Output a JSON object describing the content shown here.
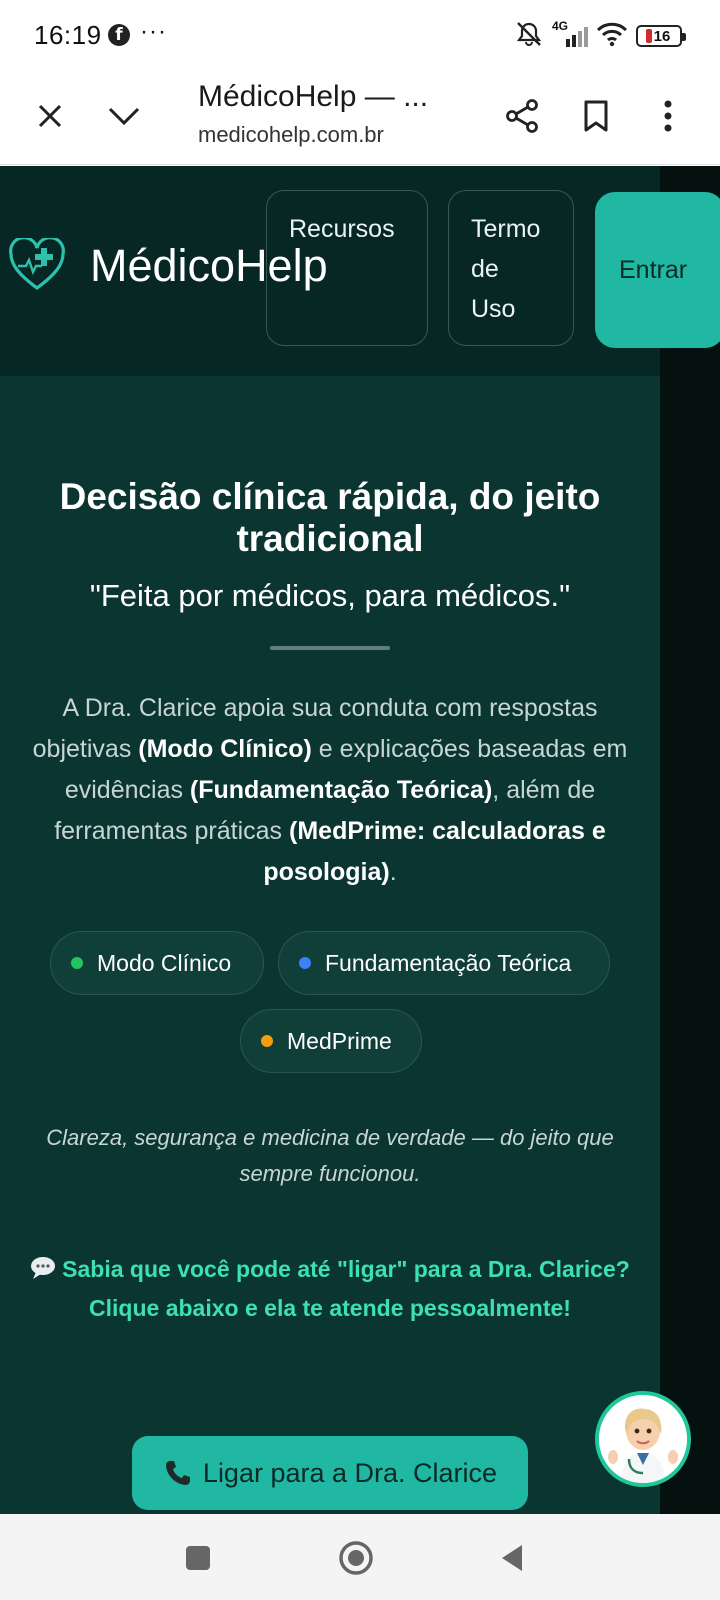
{
  "status_bar": {
    "time": "16:19",
    "notification_icon": "facebook-icon",
    "more_indicator": "···",
    "network": "4G",
    "battery_level": "16",
    "battery_color": "#d12b2b"
  },
  "browser": {
    "title": "MédicoHelp — ...",
    "url": "medicohelp.com.br"
  },
  "site": {
    "brand": "MédicoHelp",
    "nav": {
      "recursos": "Recursos",
      "termo_line1": "Termo",
      "termo_line2": "de",
      "termo_line3": "Uso",
      "entrar": "Entrar"
    }
  },
  "hero": {
    "title": "Decisão clínica rápida, do jeito tradicional",
    "subtitle": "\"Feita por médicos, para médicos.\"",
    "desc": {
      "p1": "A Dra. Clarice apoia sua conduta com respostas objetivas ",
      "b1": "(Modo Clínico)",
      "p2": " e explicações baseadas em evidências ",
      "b2": "(Fundamentação Teórica)",
      "p3": ", além de ferramentas práticas ",
      "b3": "(MedPrime: calculadoras e posologia)",
      "p4": "."
    }
  },
  "features": [
    {
      "label": "Modo Clínico",
      "color": "#22c55e"
    },
    {
      "label": "Fundamentação Teórica",
      "color": "#3b82f6"
    },
    {
      "label": "MedPrime",
      "color": "#f59e0b"
    }
  ],
  "tagline": "Clareza, segurança e medicina de verdade — do jeito que sempre funcionou.",
  "callout": {
    "icon": "speech-bubble-icon",
    "line1": "Sabia que você pode até \"ligar\" para a Dra. Clarice?",
    "line2": "Clique abaixo e ela te atende pessoalmente!"
  },
  "cta": {
    "icon": "phone-icon",
    "label": "Ligar para a Dra. Clarice"
  },
  "colors": {
    "page_bg": "#0b3530",
    "header_bg": "#072724",
    "accent": "#21b8a3",
    "callout": "#3de0b3"
  }
}
